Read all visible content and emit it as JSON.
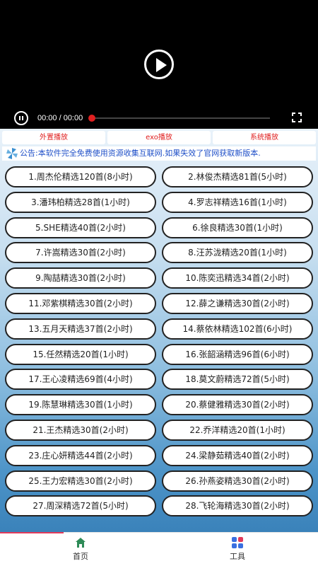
{
  "player": {
    "time_display": "00:00 / 00:00",
    "progress": 0
  },
  "tabs": [
    "外置播放",
    "exo播放",
    "系统播放"
  ],
  "notice": "公告:本软件完全免费使用资源收集互联网.如果失效了官网获取新版本.",
  "playlists": [
    "1.周杰伦精选120首(8小时)",
    "2.林俊杰精选81首(5小时)",
    "3.潘玮柏精选28首(1小时)",
    "4.罗志祥精选16首(1小时)",
    "5.SHE精选40首(2小时)",
    "6.徐良精选30首(1小时)",
    "7.许嵩精选30首(2小时)",
    "8.汪苏泷精选20首(1小时)",
    "9.陶喆精选30首(2小时)",
    "10.陈奕迅精选34首(2小时)",
    "11.邓紫棋精选30首(2小时)",
    "12.薛之谦精选30首(2小时)",
    "13.五月天精选37首(2小时)",
    "14.蔡依林精选102首(6小时)",
    "15.任然精选20首(1小时)",
    "16.张韶涵精选96首(6小时)",
    "17.王心凌精选69首(4小时)",
    "18.莫文蔚精选72首(5小时)",
    "19.陈慧琳精选30首(1小时)",
    "20.蔡健雅精选30首(2小时)",
    "21.王杰精选30首(2小时)",
    "22.乔洋精选20首(1小时)",
    "23.庄心妍精选44首(2小时)",
    "24.梁静茹精选40首(2小时)",
    "25.王力宏精选30首(2小时)",
    "26.孙燕姿精选30首(2小时)",
    "27.周深精选72首(5小时)",
    "28.飞轮海精选30首(2小时)"
  ],
  "nav": {
    "home_label": "首页",
    "tools_label": "工具"
  },
  "colors": {
    "accent": "#e02020",
    "notice_text": "#2050c8",
    "home_icon": "#2e8b57",
    "tools_icon_blue": "#3a6fe0",
    "tools_icon_red": "#e23a5a"
  }
}
